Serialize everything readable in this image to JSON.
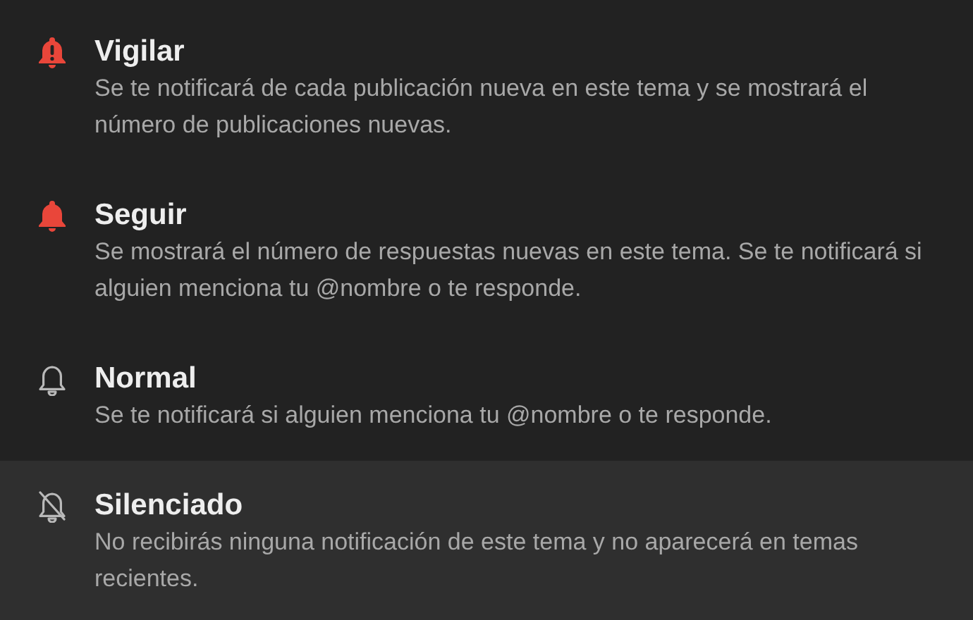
{
  "options": [
    {
      "kind": "watching",
      "title": "Vigilar",
      "description": "Se te notificará de cada publicación nueva en este tema y se mostrará el número de publicaciones nuevas.",
      "selected": false
    },
    {
      "kind": "tracking",
      "title": "Seguir",
      "description": "Se mostrará el número de respuestas nuevas en este tema. Se te notificará si alguien menciona tu @nombre o te responde.",
      "selected": false
    },
    {
      "kind": "regular",
      "title": "Normal",
      "description": "Se te notificará si alguien menciona tu @nombre o te responde.",
      "selected": false
    },
    {
      "kind": "muted",
      "title": "Silenciado",
      "description": "No recibirás ninguna notificación de este tema y no aparecerá en temas recientes.",
      "selected": true
    }
  ]
}
